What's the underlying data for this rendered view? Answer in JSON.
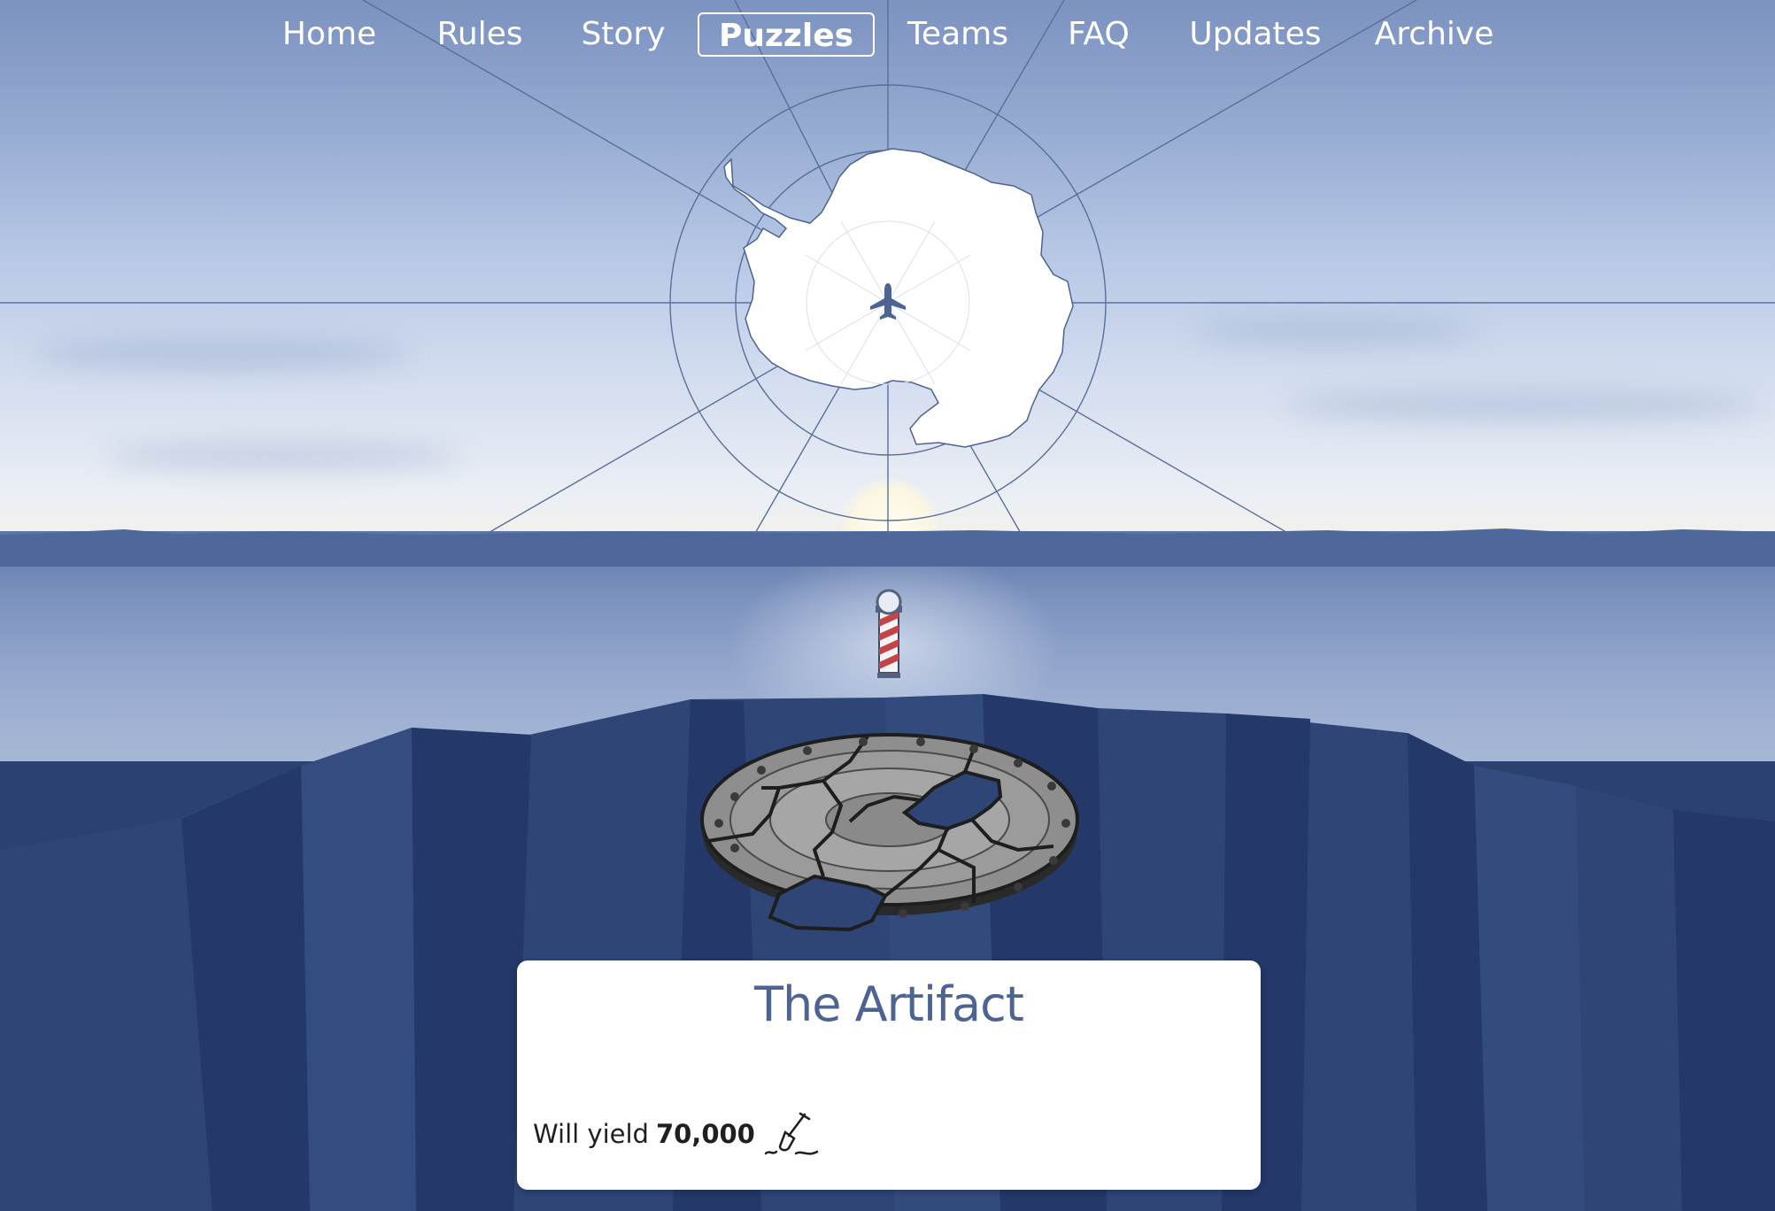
{
  "nav": {
    "items": [
      {
        "label": "Home"
      },
      {
        "label": "Rules"
      },
      {
        "label": "Story"
      },
      {
        "label": "Puzzles",
        "active": true
      },
      {
        "label": "Teams"
      },
      {
        "label": "FAQ"
      },
      {
        "label": "Updates"
      },
      {
        "label": "Archive"
      }
    ]
  },
  "map": {
    "center_icon": "airplane-icon",
    "continent": "antarctica-icon"
  },
  "scene": {
    "pole_icon": "barber-pole-marker-icon",
    "artifact_icon": "broken-stone-disc-icon"
  },
  "card": {
    "title": "The Artifact",
    "yield_prefix": "Will yield",
    "yield_value": "70,000",
    "yield_icon": "shovel-icon"
  },
  "colors": {
    "title_blue": "#4d6391",
    "cliff_dark": "#2b4170",
    "sky_top": "#7c92c0",
    "line": "#5a6f98"
  }
}
